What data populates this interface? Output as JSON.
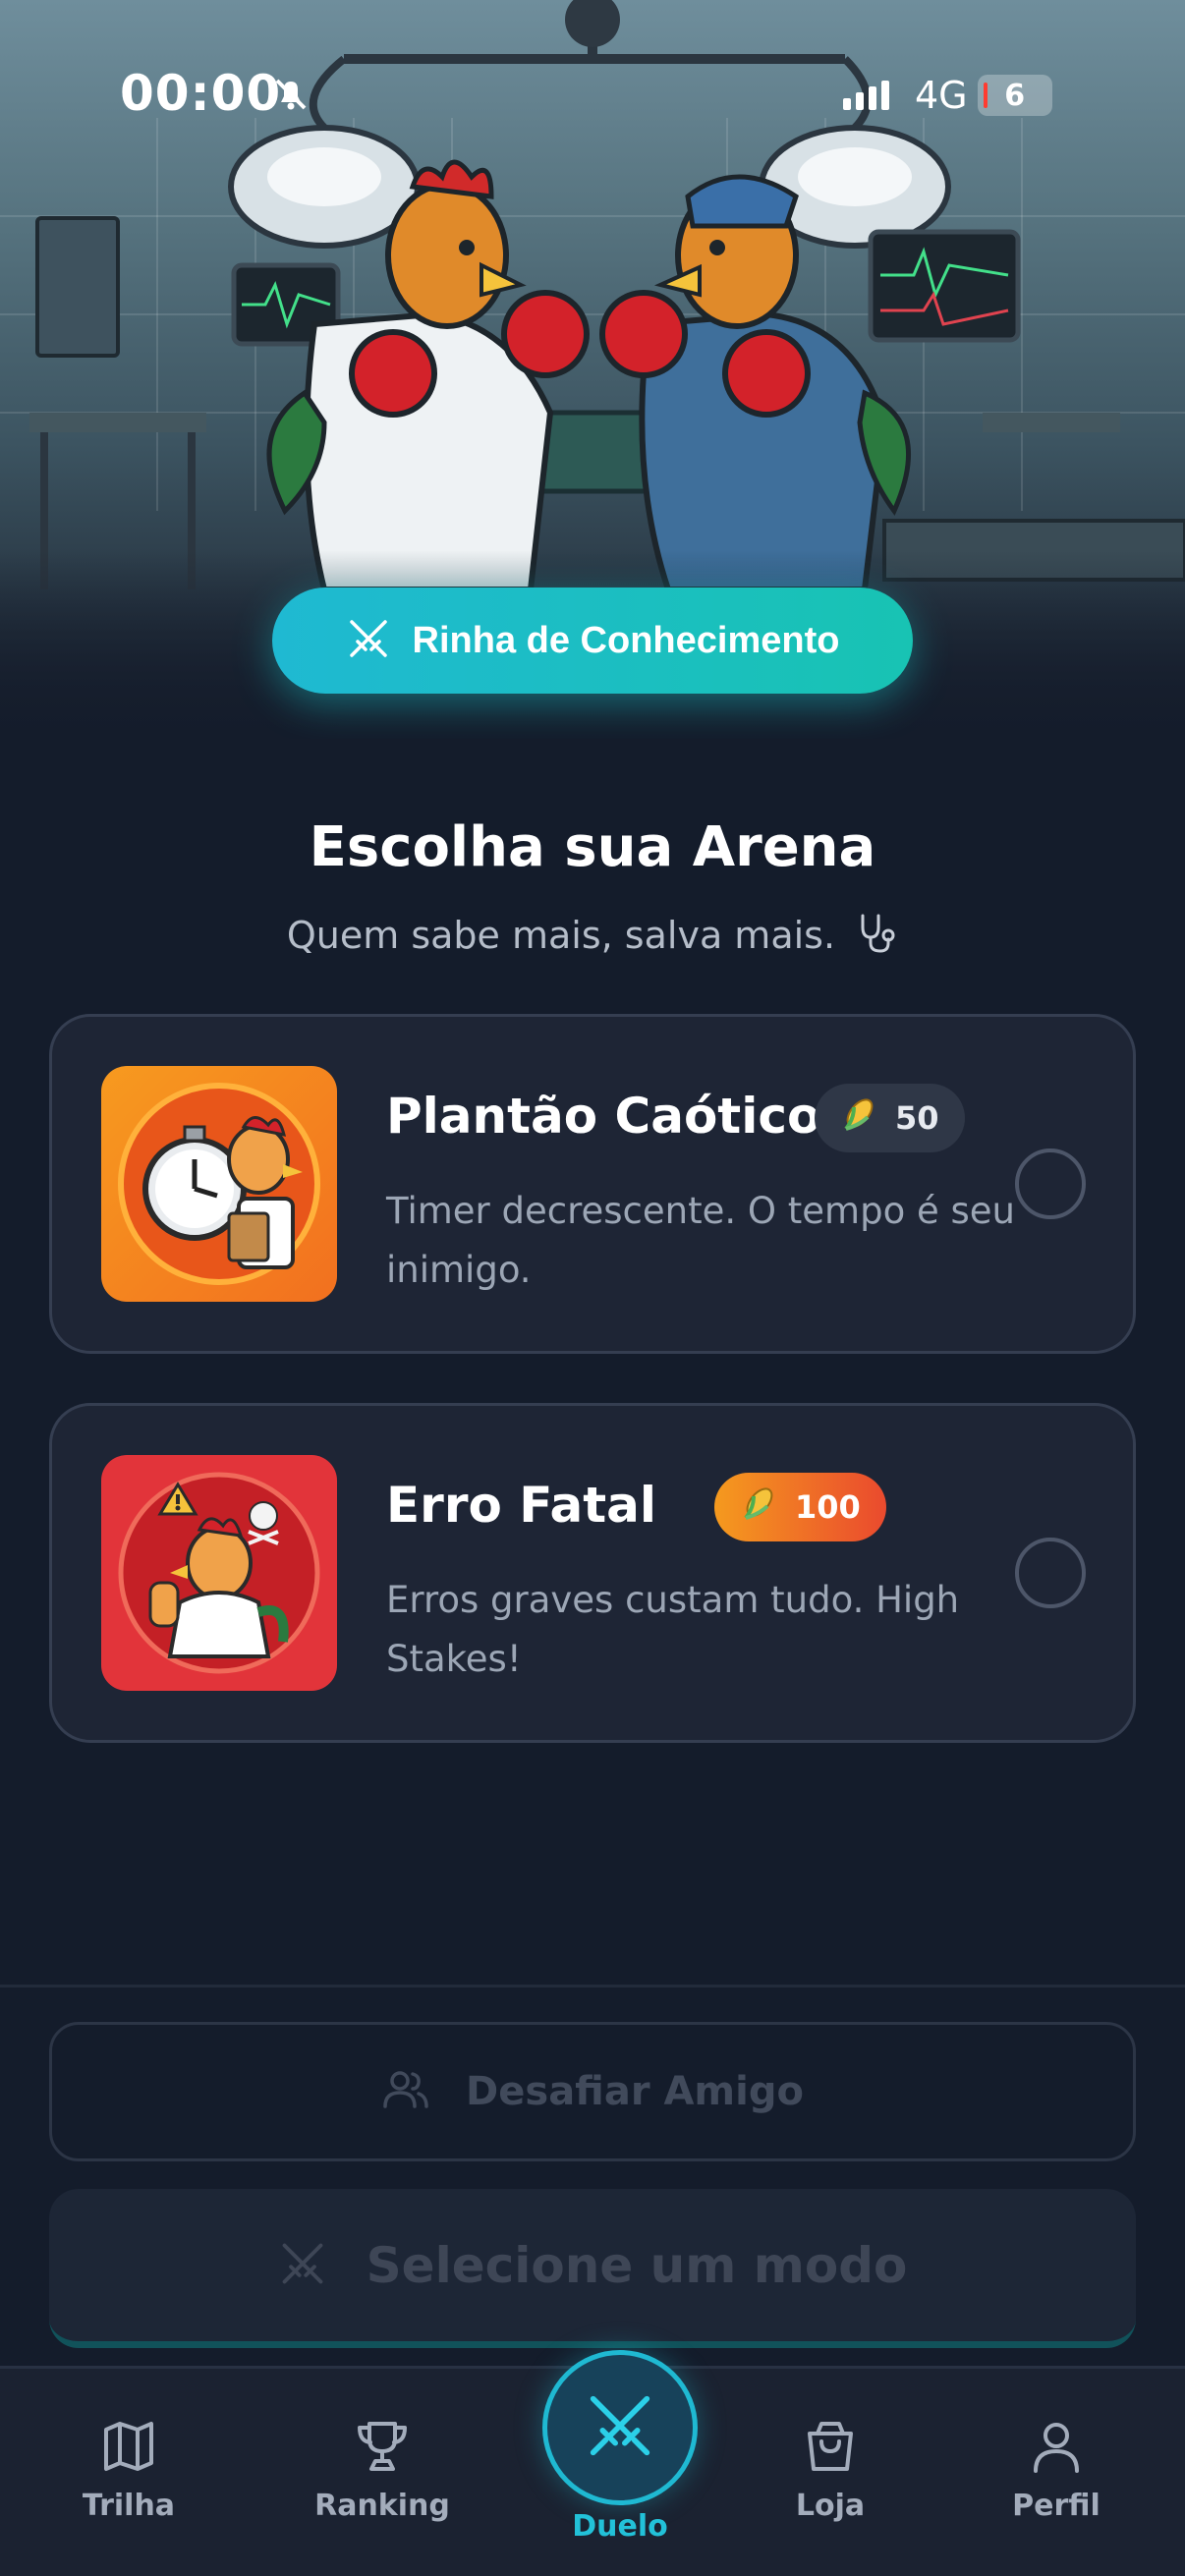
{
  "status_bar": {
    "time": "00:00",
    "network": "4G",
    "battery": "6"
  },
  "hero": {
    "pill_label": "Rinha de Conhecimento"
  },
  "arena": {
    "title": "Escolha sua Arena",
    "subtitle": "Quem sabe mais, salva mais."
  },
  "modes": [
    {
      "title": "Plantão Caótico",
      "cost": "50",
      "description": "Timer decrescente. O tempo é seu inimigo.",
      "badge_color": "#2c3443"
    },
    {
      "title": "Erro Fatal",
      "cost": "100",
      "description": "Erros graves custam tudo. High Stakes!",
      "badge_color": "#f08a1c"
    }
  ],
  "actions": {
    "challenge_friend": "Desafiar Amigo",
    "select_mode": "Selecione um modo"
  },
  "nav": {
    "items": [
      {
        "label": "Trilha",
        "icon": "map-icon"
      },
      {
        "label": "Ranking",
        "icon": "trophy-icon"
      },
      {
        "label": "Duelo",
        "icon": "crossed-swords-icon"
      },
      {
        "label": "Loja",
        "icon": "shopping-bag-icon"
      },
      {
        "label": "Perfil",
        "icon": "user-icon"
      }
    ],
    "active_index": 2,
    "accent": "#1fb9d2"
  }
}
